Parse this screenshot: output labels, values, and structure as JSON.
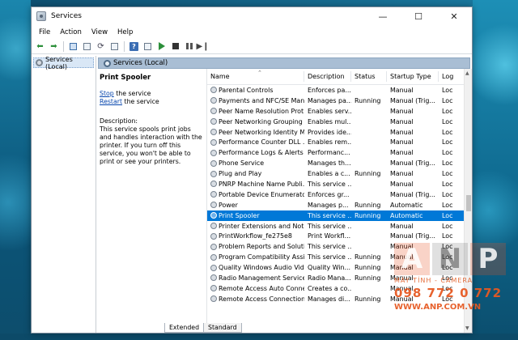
{
  "window": {
    "title": "Services"
  },
  "menu": [
    "File",
    "Action",
    "View",
    "Help"
  ],
  "tree": {
    "root_label": "Services (Local)"
  },
  "header": {
    "title": "Services (Local)"
  },
  "details": {
    "service_title": "Print Spooler",
    "stop_link": "Stop",
    "stop_suffix": " the service",
    "restart_link": "Restart",
    "restart_suffix": " the service",
    "desc_label": "Description:",
    "desc_text": "This service spools print jobs and handles interaction with the printer. If you turn off this service, you won't be able to print or see your printers."
  },
  "columns": {
    "name": "Name",
    "description": "Description",
    "status": "Status",
    "startup": "Startup Type",
    "logon": "Log"
  },
  "rows": [
    {
      "name": "Parental Controls",
      "desc": "Enforces pa...",
      "status": "",
      "startup": "Manual",
      "log": "Loc"
    },
    {
      "name": "Payments and NFC/SE Mana...",
      "desc": "Manages pa...",
      "status": "Running",
      "startup": "Manual (Trig...",
      "log": "Loc"
    },
    {
      "name": "Peer Name Resolution Prot...",
      "desc": "Enables serv...",
      "status": "",
      "startup": "Manual",
      "log": "Loc"
    },
    {
      "name": "Peer Networking Grouping",
      "desc": "Enables mul...",
      "status": "",
      "startup": "Manual",
      "log": "Loc"
    },
    {
      "name": "Peer Networking Identity M...",
      "desc": "Provides ide...",
      "status": "",
      "startup": "Manual",
      "log": "Loc"
    },
    {
      "name": "Performance Counter DLL ...",
      "desc": "Enables rem...",
      "status": "",
      "startup": "Manual",
      "log": "Loc"
    },
    {
      "name": "Performance Logs & Alerts",
      "desc": "Performanc...",
      "status": "",
      "startup": "Manual",
      "log": "Loc"
    },
    {
      "name": "Phone Service",
      "desc": "Manages th...",
      "status": "",
      "startup": "Manual (Trig...",
      "log": "Loc"
    },
    {
      "name": "Plug and Play",
      "desc": "Enables a c...",
      "status": "Running",
      "startup": "Manual",
      "log": "Loc"
    },
    {
      "name": "PNRP Machine Name Publi...",
      "desc": "This service ...",
      "status": "",
      "startup": "Manual",
      "log": "Loc"
    },
    {
      "name": "Portable Device Enumerator...",
      "desc": "Enforces gr...",
      "status": "",
      "startup": "Manual (Trig...",
      "log": "Loc"
    },
    {
      "name": "Power",
      "desc": "Manages p...",
      "status": "Running",
      "startup": "Automatic",
      "log": "Loc"
    },
    {
      "name": "Print Spooler",
      "desc": "This service ...",
      "status": "Running",
      "startup": "Automatic",
      "log": "Loc",
      "selected": true
    },
    {
      "name": "Printer Extensions and Notif...",
      "desc": "This service ...",
      "status": "",
      "startup": "Manual",
      "log": "Loc"
    },
    {
      "name": "PrintWorkflow_fe275e8",
      "desc": "Print Workfl...",
      "status": "",
      "startup": "Manual (Trig...",
      "log": "Loc"
    },
    {
      "name": "Problem Reports and Soluti...",
      "desc": "This service ...",
      "status": "",
      "startup": "Manual",
      "log": "Loc"
    },
    {
      "name": "Program Compatibility Assi...",
      "desc": "This service ...",
      "status": "Running",
      "startup": "Manual",
      "log": "Loc"
    },
    {
      "name": "Quality Windows Audio Vid...",
      "desc": "Quality Win...",
      "status": "Running",
      "startup": "Manual",
      "log": "Loc"
    },
    {
      "name": "Radio Management Service",
      "desc": "Radio Mana...",
      "status": "Running",
      "startup": "Manual",
      "log": "Loc"
    },
    {
      "name": "Remote Access Auto Conne...",
      "desc": "Creates a co...",
      "status": "",
      "startup": "Manual",
      "log": "Loc"
    },
    {
      "name": "Remote Access Connection...",
      "desc": "Manages di...",
      "status": "Running",
      "startup": "Manual",
      "log": "Loc"
    }
  ],
  "tabs": [
    "Extended",
    "Standard"
  ],
  "watermark": {
    "letters": [
      "A",
      "N",
      "P"
    ],
    "sub": "MÁY TÍNH - CAMERA",
    "phone": "098 772 0 772",
    "url": "WWW.ANP.COM.VN"
  },
  "colors": {
    "selection": "#0078d7",
    "header_bar": "#a9bed4",
    "link": "#0645ad"
  }
}
